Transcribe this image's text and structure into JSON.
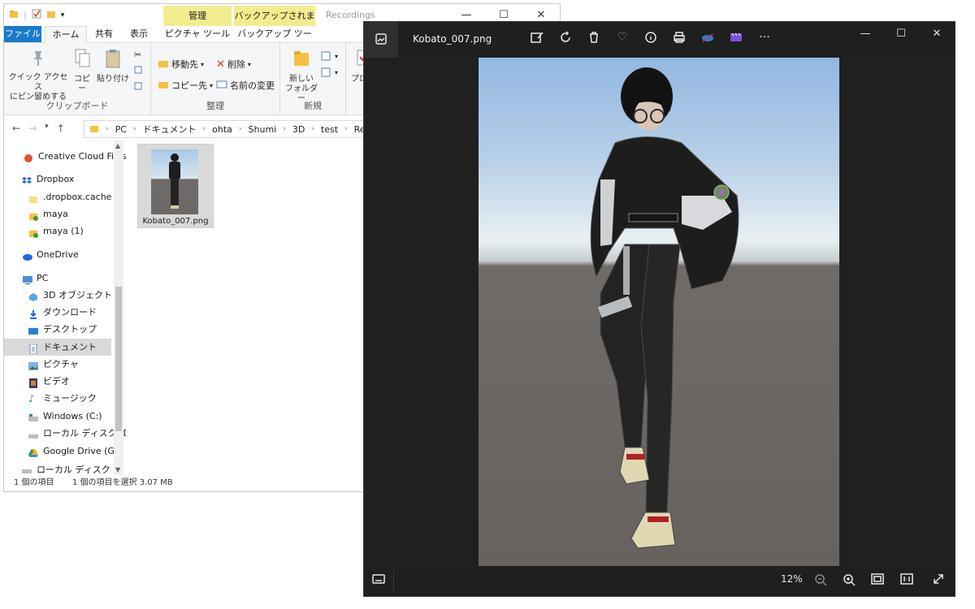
{
  "explorer": {
    "title": "Recordings",
    "context_tabs": {
      "manage": "管理",
      "backup_status": "バックアップされません"
    },
    "tabs": [
      "ファイル",
      "ホーム",
      "共有",
      "表示",
      "ピクチャ ツール",
      "バックアップ ツール"
    ],
    "ribbon": {
      "pin_label_1": "クイック アクセス",
      "pin_label_2": "にピン留めする",
      "copy": "コピー",
      "paste": "貼り付け",
      "clipboard_group": "クリップボード",
      "move_to": "移動先",
      "copy_to": "コピー先",
      "delete": "削除",
      "rename": "名前の変更",
      "organize_group": "整理",
      "new_folder_1": "新しい",
      "new_folder_2": "フォルダー",
      "new_group": "新規",
      "properties": "プロパ"
    },
    "address": [
      "PC",
      "ドキュメント",
      "ohta",
      "Shumi",
      "3D",
      "test",
      "Recordings"
    ],
    "nav_items": [
      "Creative Cloud Files",
      "Dropbox",
      ".dropbox.cache",
      "maya",
      "maya (1)",
      "OneDrive",
      "PC",
      "3D オブジェクト",
      "ダウンロード",
      "デスクトップ",
      "ドキュメント",
      "ピクチャ",
      "ビデオ",
      "ミュージック",
      "Windows (C:)",
      "ローカル ディスク (D:)",
      "Google Drive (G:)",
      "ローカル ディスク (D:)"
    ],
    "file": {
      "name": "Kobato_007.png"
    },
    "status": {
      "count": "1 個の項目",
      "selected": "1 個の項目を選択  3.07 MB"
    }
  },
  "viewer": {
    "filename": "Kobato_007.png",
    "zoom": "12%"
  },
  "colors": {
    "accent": "#1979ca",
    "context_tab": "#f3ec8f",
    "viewer_bg": "#1f1f1f"
  }
}
